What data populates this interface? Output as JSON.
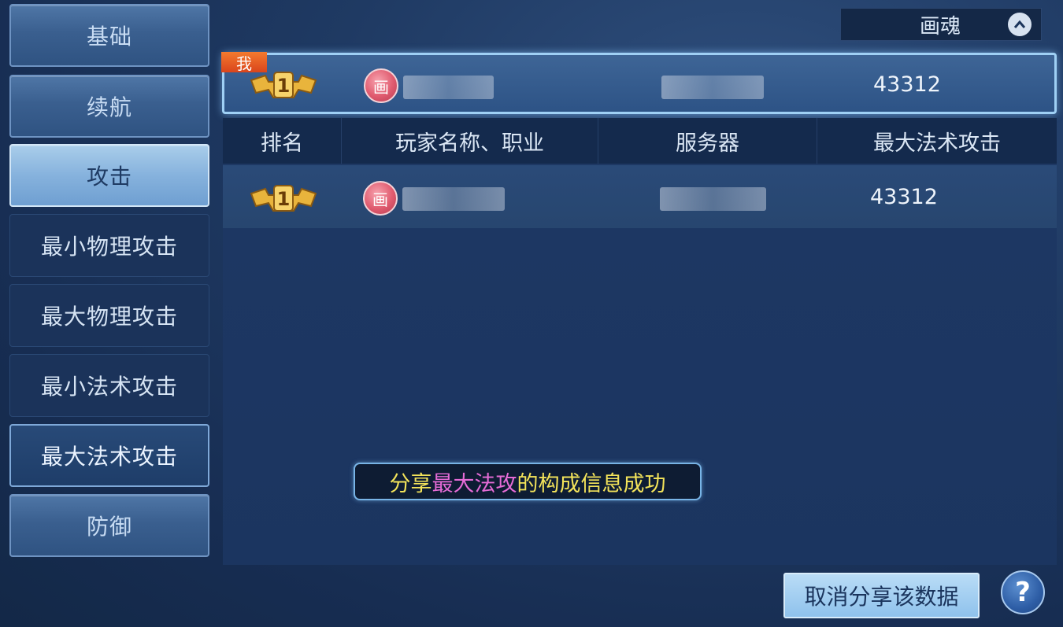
{
  "sidebar": {
    "items": [
      {
        "label": "基础",
        "style": "main",
        "active": false
      },
      {
        "label": "续航",
        "style": "main",
        "active": false
      },
      {
        "label": "攻击",
        "style": "main",
        "active": true
      },
      {
        "label": "最小物理攻击",
        "style": "sub",
        "active": false
      },
      {
        "label": "最大物理攻击",
        "style": "sub",
        "active": false
      },
      {
        "label": "最小法术攻击",
        "style": "sub",
        "active": false
      },
      {
        "label": "最大法术攻击",
        "style": "sub",
        "active": true
      },
      {
        "label": "防御",
        "style": "main",
        "active": false
      }
    ]
  },
  "filter": {
    "selected": "画魂",
    "icon": "chevron-up-icon"
  },
  "my_row": {
    "badge": "我",
    "rank": "1",
    "class_icon": "画",
    "score": "43312"
  },
  "table": {
    "headers": [
      "排名",
      "玩家名称、职业",
      "服务器",
      "最大法术攻击"
    ],
    "rows": [
      {
        "rank": "1",
        "class_icon": "画",
        "score": "43312"
      }
    ]
  },
  "toast": {
    "part1": "分享",
    "part2": "最大法攻",
    "part3": "的构成信息成功"
  },
  "actions": {
    "cancel_share": "取消分享该数据",
    "help": "?"
  },
  "colors": {
    "accent": "#9fd0f5",
    "toast_yellow": "#f3e35a",
    "toast_magenta": "#e56bd6",
    "badge_orange": "#e0561f"
  }
}
